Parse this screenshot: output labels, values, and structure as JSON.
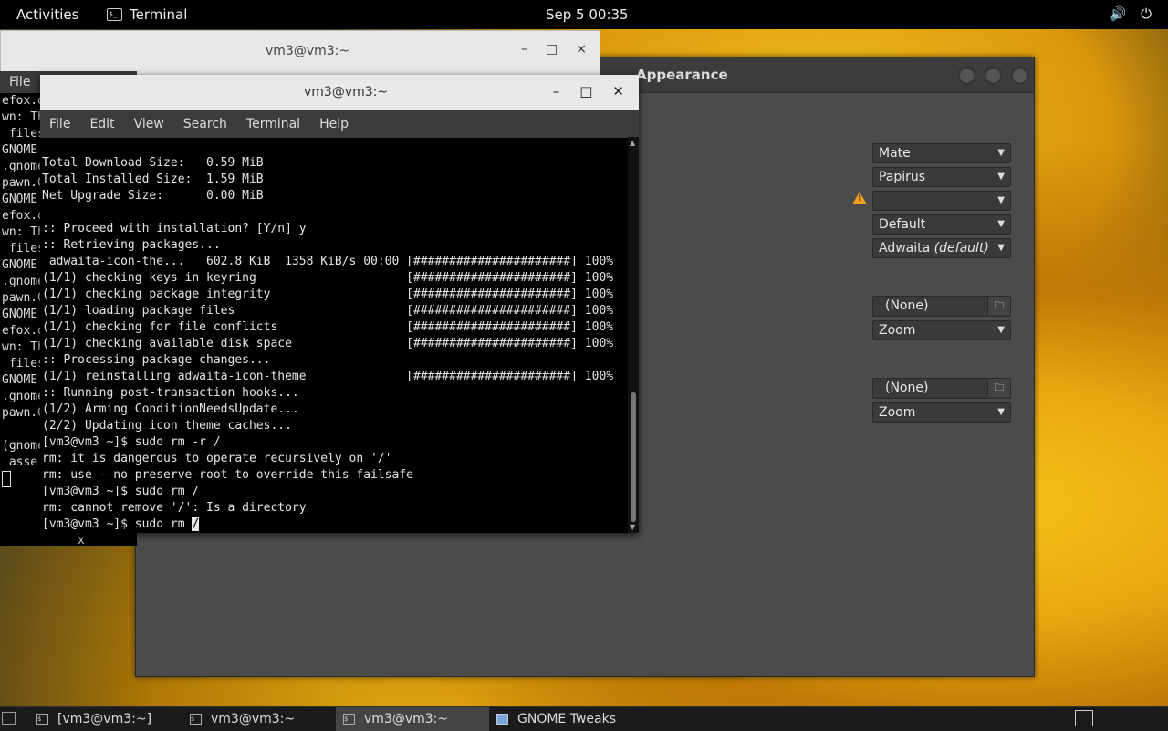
{
  "topbar": {
    "activities": "Activities",
    "app_name": "Terminal",
    "clock": "Sep 5  00:35",
    "volume_icon": "volume-icon",
    "power_icon": "power-icon"
  },
  "back_terminal_1": {
    "title": "vm3@vm3:~"
  },
  "back_terminal_2": {
    "menu_file": "File",
    "lines": [
      "efox.d",
      "wn: Th",
      " files",
      "GNOME",
      ".gnome",
      "pawn.G",
      "GNOME",
      "efox.d",
      "wn: Th",
      " files",
      "GNOME",
      ".gnome",
      "pawn.G",
      "GNOME",
      "efox.d",
      "wn: Th",
      " files",
      "GNOME",
      ".gnome",
      "pawn.G",
      "",
      "(gnome",
      " asse"
    ],
    "stray": "x"
  },
  "tweaks": {
    "title": "Appearance",
    "combos": {
      "applications": "Mate",
      "icons": "Papirus",
      "shell": "",
      "sound": "Default",
      "cursor": "Adwaita",
      "cursor_suffix": "(default)",
      "bg_image": "(None)",
      "bg_adjust": "Zoom",
      "lock_image": "(None)",
      "lock_adjust": "Zoom"
    }
  },
  "terminal": {
    "title": "vm3@vm3:~",
    "menu": [
      "File",
      "Edit",
      "View",
      "Search",
      "Terminal",
      "Help"
    ],
    "lines": [
      "",
      "Total Download Size:   0.59 MiB",
      "Total Installed Size:  1.59 MiB",
      "Net Upgrade Size:      0.00 MiB",
      "",
      ":: Proceed with installation? [Y/n] y",
      ":: Retrieving packages...",
      " adwaita-icon-the...   602.8 KiB  1358 KiB/s 00:00 [######################] 100%",
      "(1/1) checking keys in keyring                     [######################] 100%",
      "(1/1) checking package integrity                   [######################] 100%",
      "(1/1) loading package files                        [######################] 100%",
      "(1/1) checking for file conflicts                  [######################] 100%",
      "(1/1) checking available disk space                [######################] 100%",
      ":: Processing package changes...",
      "(1/1) reinstalling adwaita-icon-theme              [######################] 100%",
      ":: Running post-transaction hooks...",
      "(1/2) Arming ConditionNeedsUpdate...",
      "(2/2) Updating icon theme caches...",
      "[vm3@vm3 ~]$ sudo rm -r /",
      "rm: it is dangerous to operate recursively on '/'",
      "rm: use --no-preserve-root to override this failsafe",
      "[vm3@vm3 ~]$ sudo rm /",
      "rm: cannot remove '/': Is a directory"
    ],
    "prompt_line": "[vm3@vm3 ~]$ sudo rm ",
    "cursor_char": "/"
  },
  "taskbar": {
    "items": [
      {
        "label": "[vm3@vm3:~]"
      },
      {
        "label": "vm3@vm3:~"
      },
      {
        "label": "vm3@vm3:~"
      },
      {
        "label": "GNOME Tweaks"
      }
    ]
  }
}
